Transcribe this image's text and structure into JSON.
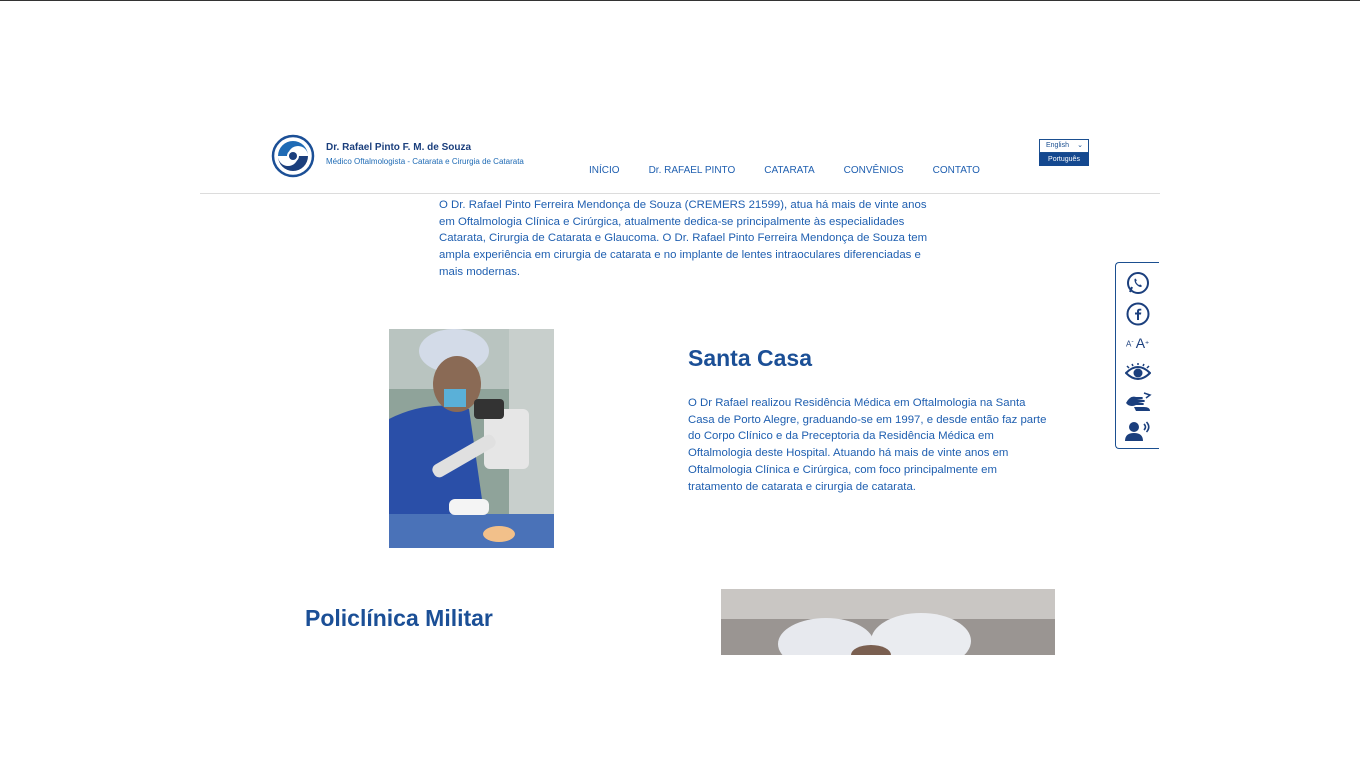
{
  "header": {
    "brand_name": "Dr. Rafael Pinto F. M. de Souza",
    "brand_sub": "Médico Oftalmologista - Catarata e Cirurgia de Catarata",
    "nav": [
      "INÍCIO",
      "Dr. RAFAEL PINTO",
      "CATARATA",
      "CONVÊNIOS",
      "CONTATO"
    ],
    "lang_selected": "English",
    "lang_option": "Português"
  },
  "intro": "O Dr. Rafael Pinto Ferreira Mendonça de Souza (CREMERS 21599), atua há mais de vinte anos em Oftalmologia Clínica e Cirúrgica, atualmente dedica-se principalmente às especialidades Catarata, Cirurgia de Catarata e Glaucoma. O Dr. Rafael Pinto Ferreira Mendonça de Souza tem ampla experiência em cirurgia de catarata e no implante de lentes intraoculares diferenciadas e mais modernas.",
  "santa_casa": {
    "title": "Santa Casa",
    "text": "O Dr Rafael realizou Residência Médica em Oftalmologia na Santa Casa de Porto Alegre, graduando-se em 1997, e desde então faz parte do Corpo Clínico e da Preceptoria da Residência Médica em Oftalmologia deste Hospital. Atuando há mais de vinte anos em Oftalmologia Clínica e Cirúrgica, com foco principalmente em tratamento de catarata e cirurgia de catarata."
  },
  "policlinica": {
    "title": "Policlínica Militar"
  },
  "accessibility": {
    "icons": [
      "whatsapp-icon",
      "facebook-icon",
      "font-size-icon",
      "contrast-eye-icon",
      "sign-language-icon",
      "screen-reader-icon"
    ],
    "font_small": "A",
    "font_large": "A"
  },
  "colors": {
    "primary": "#1b4f96",
    "link": "#1f5fb0"
  }
}
